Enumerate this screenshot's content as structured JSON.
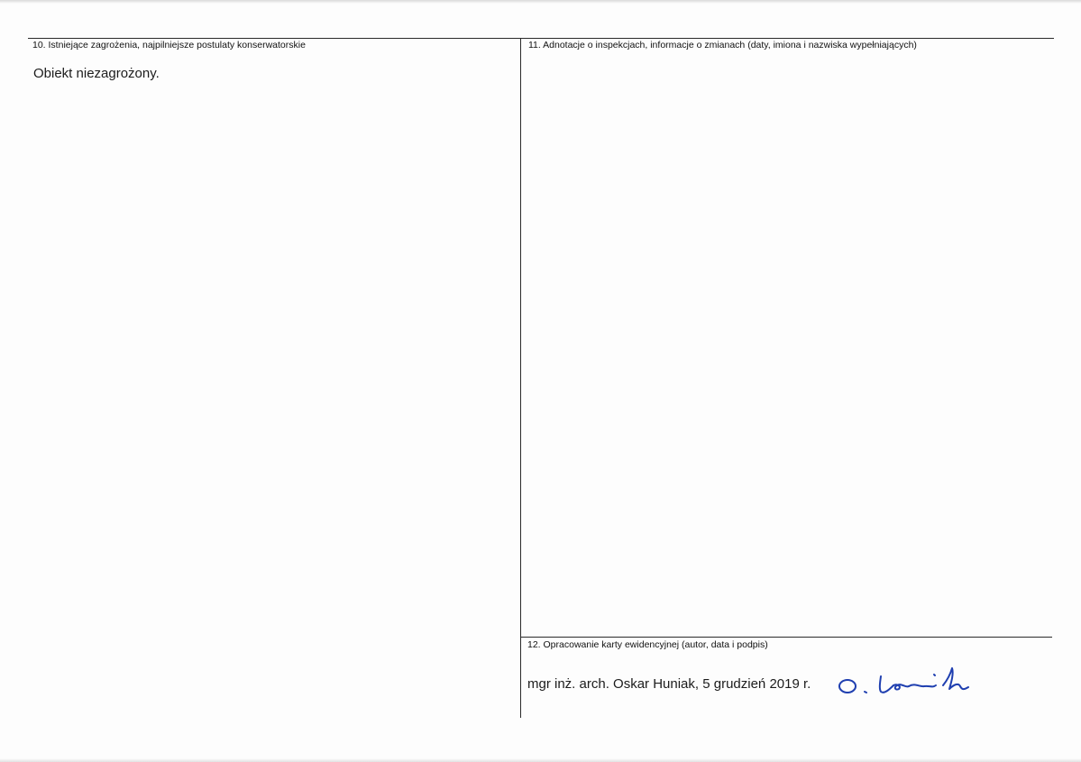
{
  "section10": {
    "label": "10. Istniejące zagrożenia, najpilniejsze postulaty konserwatorskie",
    "content": "Obiekt niezagrożony."
  },
  "section11": {
    "label": "11. Adnotacje o inspekcjach, informacje o zmianach (daty, imiona i nazwiska wypełniających)",
    "content": ""
  },
  "section12": {
    "label": "12. Opracowanie karty ewidencyjnej (autor, data i podpis)",
    "author_line": "mgr inż. arch. Oskar Huniak, 5 grudzień 2019 r."
  }
}
